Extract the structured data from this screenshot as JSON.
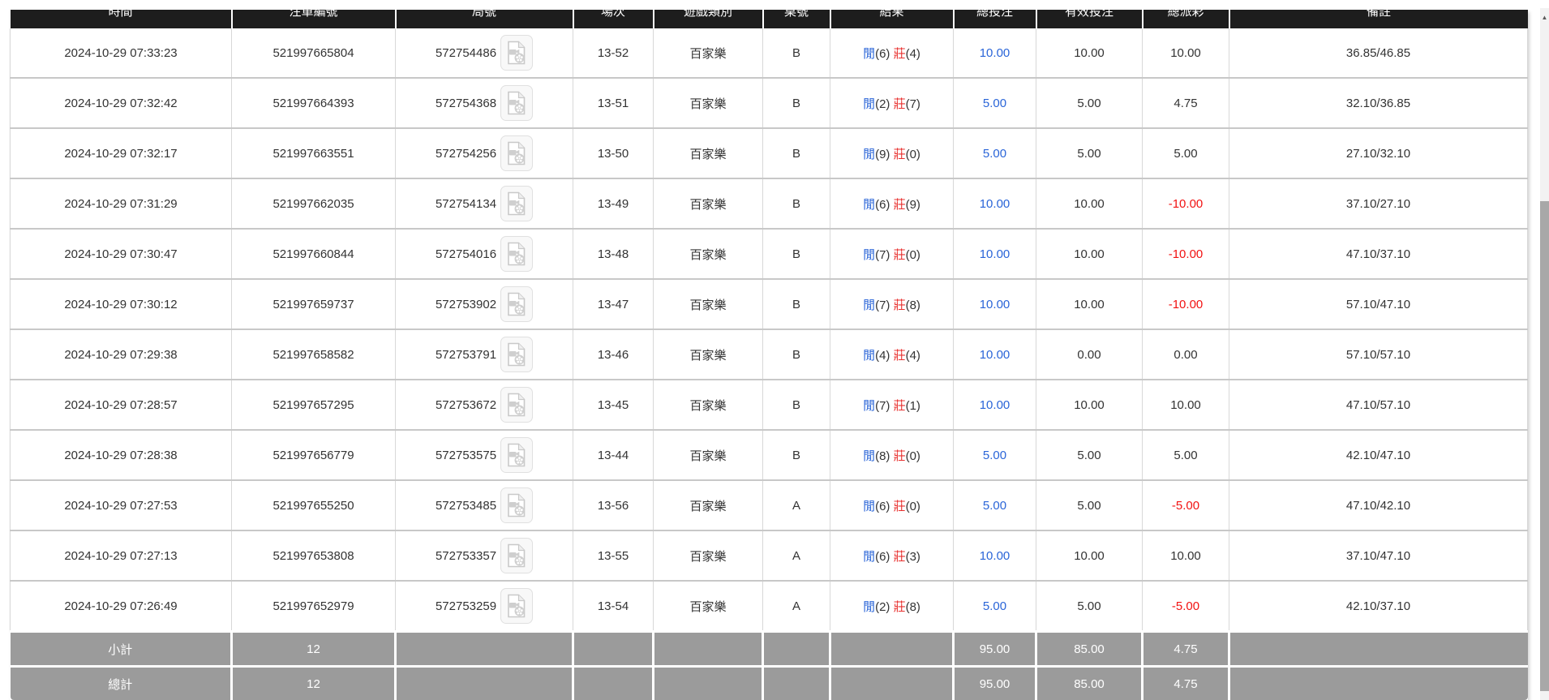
{
  "colors": {
    "header_bg": "#1d1d1d",
    "header_text": "#ffffff",
    "row_text": "#333333",
    "link_blue": "#2a65d8",
    "player_blue": "#2a65d8",
    "banker_red": "#e8312f",
    "loss_red": "#f21212",
    "footer_bg": "#9b9b9b",
    "footer_text": "#ffffff",
    "border_gray": "#c8c8c8",
    "scrollbar_track": "#f2f2f2",
    "scrollbar_thumb": "#a8a8a8"
  },
  "scrollbar": {
    "up_arrow": "▲"
  },
  "table": {
    "columns": [
      {
        "key": "time",
        "label": "時間"
      },
      {
        "key": "bet_id",
        "label": "注單編號"
      },
      {
        "key": "round",
        "label": "局號"
      },
      {
        "key": "session",
        "label": "場次"
      },
      {
        "key": "game_type",
        "label": "遊戲類別"
      },
      {
        "key": "table_no",
        "label": "桌號"
      },
      {
        "key": "result",
        "label": "結果"
      },
      {
        "key": "total_bet",
        "label": "總投注"
      },
      {
        "key": "valid_bet",
        "label": "有效投注"
      },
      {
        "key": "payout",
        "label": "總派彩"
      },
      {
        "key": "remark",
        "label": "備註"
      }
    ],
    "result_labels": {
      "player": "閒",
      "banker": "莊"
    },
    "icon_name": "video-file-icon",
    "rows": [
      {
        "time": "2024-10-29 07:33:23",
        "bet_id": "521997665804",
        "round": "572754486",
        "session": "13-52",
        "game_type": "百家樂",
        "table_no": "B",
        "player": "6",
        "banker": "4",
        "total_bet": "10.00",
        "valid_bet": "10.00",
        "payout": "10.00",
        "remark": "36.85/46.85"
      },
      {
        "time": "2024-10-29 07:32:42",
        "bet_id": "521997664393",
        "round": "572754368",
        "session": "13-51",
        "game_type": "百家樂",
        "table_no": "B",
        "player": "2",
        "banker": "7",
        "total_bet": "5.00",
        "valid_bet": "5.00",
        "payout": "4.75",
        "remark": "32.10/36.85"
      },
      {
        "time": "2024-10-29 07:32:17",
        "bet_id": "521997663551",
        "round": "572754256",
        "session": "13-50",
        "game_type": "百家樂",
        "table_no": "B",
        "player": "9",
        "banker": "0",
        "total_bet": "5.00",
        "valid_bet": "5.00",
        "payout": "5.00",
        "remark": "27.10/32.10"
      },
      {
        "time": "2024-10-29 07:31:29",
        "bet_id": "521997662035",
        "round": "572754134",
        "session": "13-49",
        "game_type": "百家樂",
        "table_no": "B",
        "player": "6",
        "banker": "9",
        "total_bet": "10.00",
        "valid_bet": "10.00",
        "payout": "-10.00",
        "remark": "37.10/27.10"
      },
      {
        "time": "2024-10-29 07:30:47",
        "bet_id": "521997660844",
        "round": "572754016",
        "session": "13-48",
        "game_type": "百家樂",
        "table_no": "B",
        "player": "7",
        "banker": "0",
        "total_bet": "10.00",
        "valid_bet": "10.00",
        "payout": "-10.00",
        "remark": "47.10/37.10"
      },
      {
        "time": "2024-10-29 07:30:12",
        "bet_id": "521997659737",
        "round": "572753902",
        "session": "13-47",
        "game_type": "百家樂",
        "table_no": "B",
        "player": "7",
        "banker": "8",
        "total_bet": "10.00",
        "valid_bet": "10.00",
        "payout": "-10.00",
        "remark": "57.10/47.10"
      },
      {
        "time": "2024-10-29 07:29:38",
        "bet_id": "521997658582",
        "round": "572753791",
        "session": "13-46",
        "game_type": "百家樂",
        "table_no": "B",
        "player": "4",
        "banker": "4",
        "total_bet": "10.00",
        "valid_bet": "0.00",
        "payout": "0.00",
        "remark": "57.10/57.10"
      },
      {
        "time": "2024-10-29 07:28:57",
        "bet_id": "521997657295",
        "round": "572753672",
        "session": "13-45",
        "game_type": "百家樂",
        "table_no": "B",
        "player": "7",
        "banker": "1",
        "total_bet": "10.00",
        "valid_bet": "10.00",
        "payout": "10.00",
        "remark": "47.10/57.10"
      },
      {
        "time": "2024-10-29 07:28:38",
        "bet_id": "521997656779",
        "round": "572753575",
        "session": "13-44",
        "game_type": "百家樂",
        "table_no": "B",
        "player": "8",
        "banker": "0",
        "total_bet": "5.00",
        "valid_bet": "5.00",
        "payout": "5.00",
        "remark": "42.10/47.10"
      },
      {
        "time": "2024-10-29 07:27:53",
        "bet_id": "521997655250",
        "round": "572753485",
        "session": "13-56",
        "game_type": "百家樂",
        "table_no": "A",
        "player": "6",
        "banker": "0",
        "total_bet": "5.00",
        "valid_bet": "5.00",
        "payout": "-5.00",
        "remark": "47.10/42.10"
      },
      {
        "time": "2024-10-29 07:27:13",
        "bet_id": "521997653808",
        "round": "572753357",
        "session": "13-55",
        "game_type": "百家樂",
        "table_no": "A",
        "player": "6",
        "banker": "3",
        "total_bet": "10.00",
        "valid_bet": "10.00",
        "payout": "10.00",
        "remark": "37.10/47.10"
      },
      {
        "time": "2024-10-29 07:26:49",
        "bet_id": "521997652979",
        "round": "572753259",
        "session": "13-54",
        "game_type": "百家樂",
        "table_no": "A",
        "player": "2",
        "banker": "8",
        "total_bet": "5.00",
        "valid_bet": "5.00",
        "payout": "-5.00",
        "remark": "42.10/37.10"
      }
    ],
    "footer": [
      {
        "label": "小計",
        "count": "12",
        "total_bet": "95.00",
        "valid_bet": "85.00",
        "payout": "4.75"
      },
      {
        "label": "總計",
        "count": "12",
        "total_bet": "95.00",
        "valid_bet": "85.00",
        "payout": "4.75"
      }
    ]
  }
}
